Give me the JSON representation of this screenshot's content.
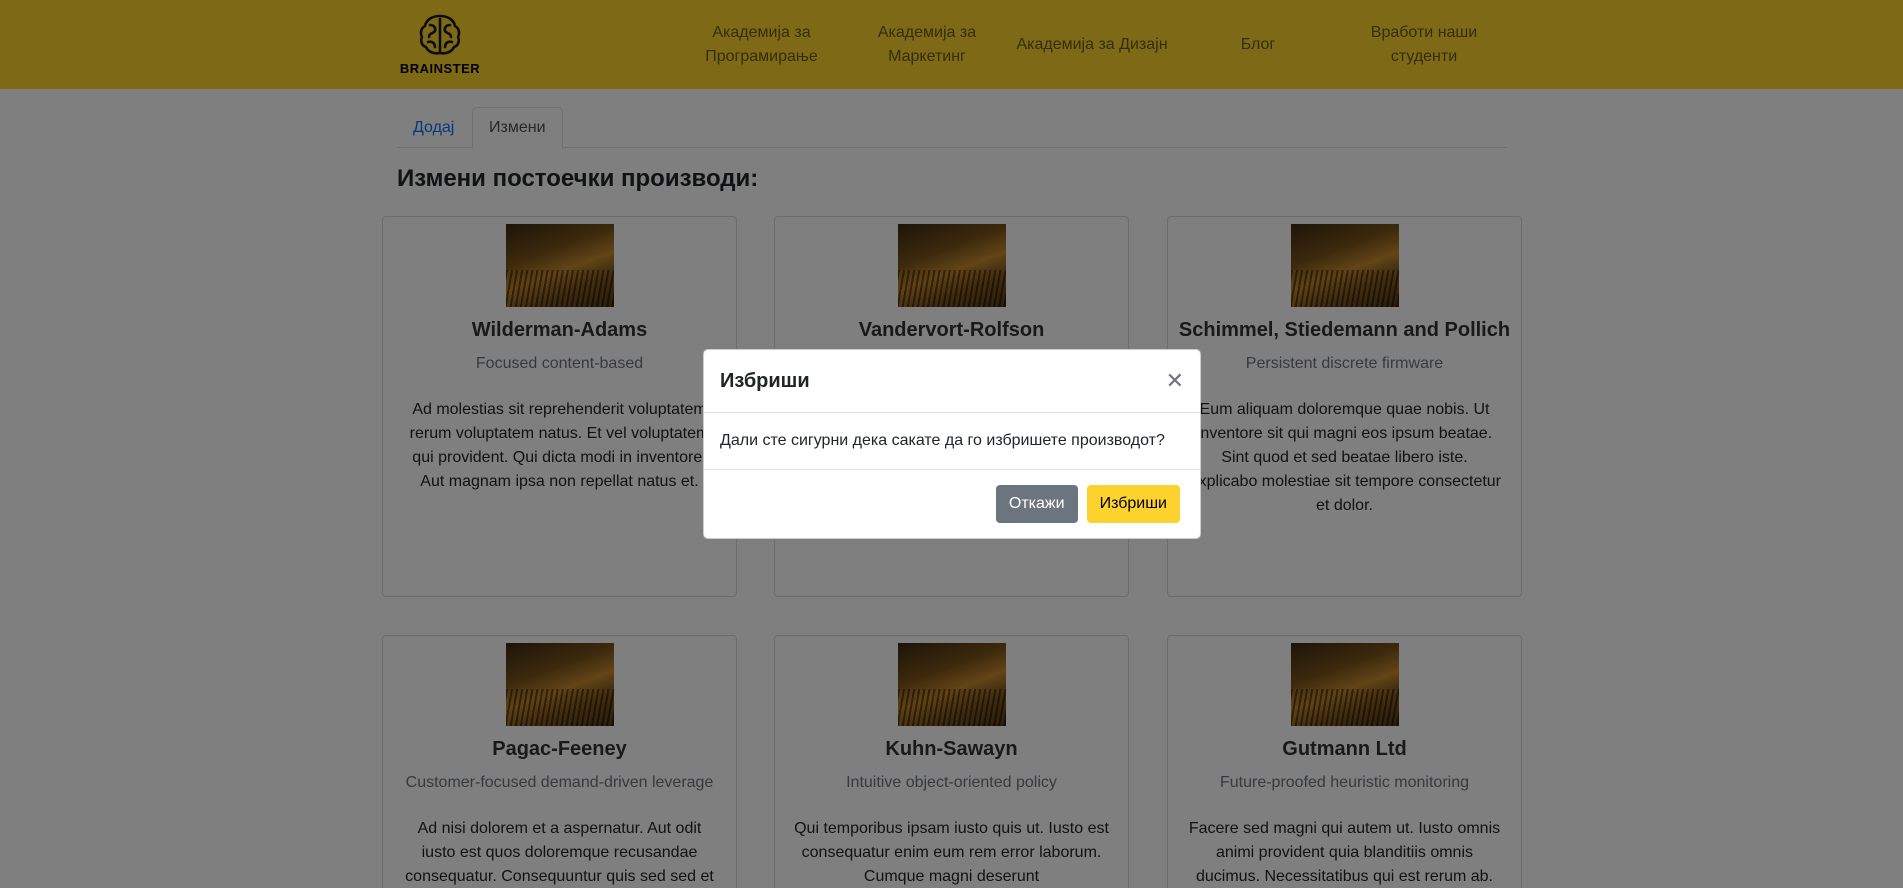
{
  "brand": {
    "logo_text": "BRAINSTER",
    "accent_color": "#fdd22f"
  },
  "nav": {
    "items": [
      {
        "label": "Академија за Програмирање"
      },
      {
        "label": "Академија за Маркетинг"
      },
      {
        "label": "Академија за Дизајн"
      },
      {
        "label": "Блог"
      },
      {
        "label": "Вработи наши студенти"
      }
    ]
  },
  "tabs": [
    {
      "label": "Додај"
    },
    {
      "label": "Измени"
    }
  ],
  "page_title": "Измени постоечки производи:",
  "cards": [
    {
      "title": "Wilderman-Adams",
      "subtitle": "Focused content-based",
      "text": "Ad molestias sit reprehenderit voluptatem rerum voluptatem natus. Et vel voluptatem qui provident. Qui dicta modi in inventore. Aut magnam ipsa non repellat natus et."
    },
    {
      "title": "Vandervort-Rolfson",
      "subtitle": "",
      "text": ""
    },
    {
      "title": "Schimmel, Stiedemann and Pollich",
      "subtitle": "Persistent discrete firmware",
      "text": "Eum aliquam doloremque quae nobis. Ut inventore sit qui magni eos ipsum beatae. Sint quod et sed beatae libero iste. Explicabo molestiae sit tempore consectetur et dolor."
    },
    {
      "title": "Pagac-Feeney",
      "subtitle": "Customer-focused demand-driven leverage",
      "text": "Ad nisi dolorem et a aspernatur. Aut odit iusto est quos doloremque recusandae consequatur. Consequuntur quis sed sed et"
    },
    {
      "title": "Kuhn-Sawayn",
      "subtitle": "Intuitive object-oriented policy",
      "text": "Qui temporibus ipsam iusto quis ut. Iusto est consequatur enim eum rem error laborum. Cumque magni deserunt"
    },
    {
      "title": "Gutmann Ltd",
      "subtitle": "Future-proofed heuristic monitoring",
      "text": "Facere sed magni qui autem ut. Iusto omnis animi provident quia blanditiis omnis ducimus. Necessitatibus qui est rerum ab."
    }
  ],
  "modal": {
    "title": "Избриши",
    "close_icon": "close-icon",
    "body": "Дали сте сигурни дека сакате да го избришете производот?",
    "cancel_label": "Откажи",
    "delete_label": "Избриши"
  }
}
